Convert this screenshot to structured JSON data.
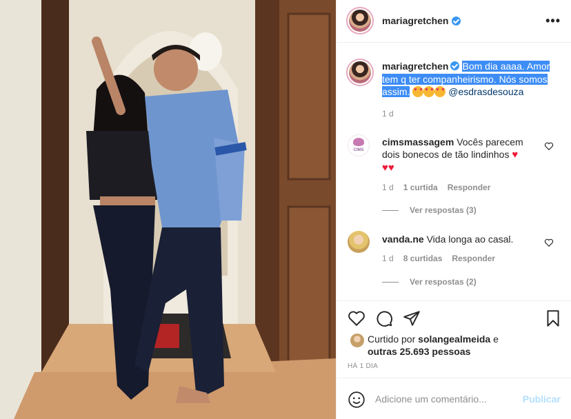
{
  "post": {
    "author": "mariagretchen",
    "more_icon": "more-dots-icon",
    "caption": {
      "username": "mariagretchen",
      "text_part1": "Bom dia aaaa. Amor",
      "text_part2": "tem q ter companheirismo. Nós somos",
      "text_part3": "assim.",
      "mention": "@esdrasdesouza",
      "time": "1 d"
    },
    "comments": [
      {
        "username": "cimsmassagem",
        "avatar_label": "CIMS",
        "text_line1": "Vocês parecem",
        "text_line2": "dois bonecos de tão lindinhos",
        "time": "1 d",
        "likes": "1 curtida",
        "reply": "Responder",
        "view_replies": "Ver respostas (3)"
      },
      {
        "username": "vanda.ne",
        "text": "Vida longa ao casal.",
        "time": "1 d",
        "likes": "8 curtidas",
        "reply": "Responder",
        "view_replies": "Ver respostas (2)"
      }
    ],
    "liked_by": {
      "prefix": "Curtido por",
      "user": "solangealmeida",
      "conj": "e",
      "others": "outras 25.693 pessoas"
    },
    "time_ago": "HÁ 1 DIA",
    "add_comment": {
      "placeholder": "Adicione um comentário...",
      "post_label": "Publicar"
    }
  },
  "colors": {
    "highlight": "#3d8df5",
    "verified": "#3897f0",
    "mention": "#00376b",
    "publish_disabled": "#b2dffc"
  }
}
